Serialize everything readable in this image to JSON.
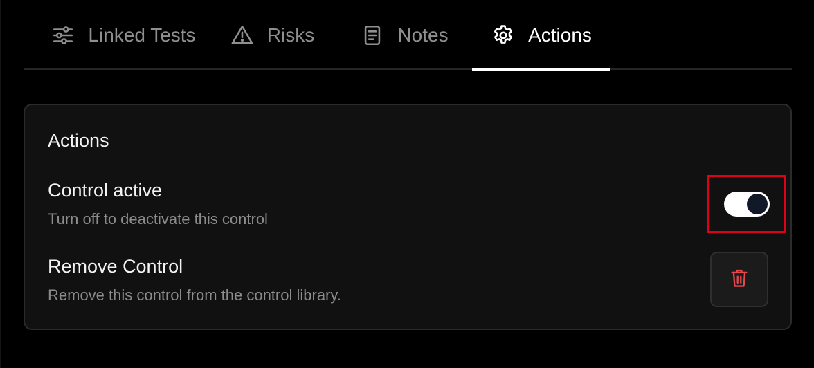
{
  "tabs": [
    {
      "label": "Linked Tests",
      "icon": "sliders-icon",
      "active": false
    },
    {
      "label": "Risks",
      "icon": "warning-triangle-icon",
      "active": false
    },
    {
      "label": "Notes",
      "icon": "document-icon",
      "active": false
    },
    {
      "label": "Actions",
      "icon": "gear-icon",
      "active": true
    }
  ],
  "actions_card": {
    "title": "Actions",
    "control_active": {
      "title": "Control active",
      "description": "Turn off to deactivate this control",
      "toggle_on": true
    },
    "remove_control": {
      "title": "Remove Control",
      "description": "Remove this control from the control library.",
      "button_icon": "trash-icon"
    }
  },
  "colors": {
    "background": "#000000",
    "card_background": "#111111",
    "highlight_border": "#e0001a",
    "trash_icon": "#e5484d",
    "toggle_knob": "#111827"
  }
}
